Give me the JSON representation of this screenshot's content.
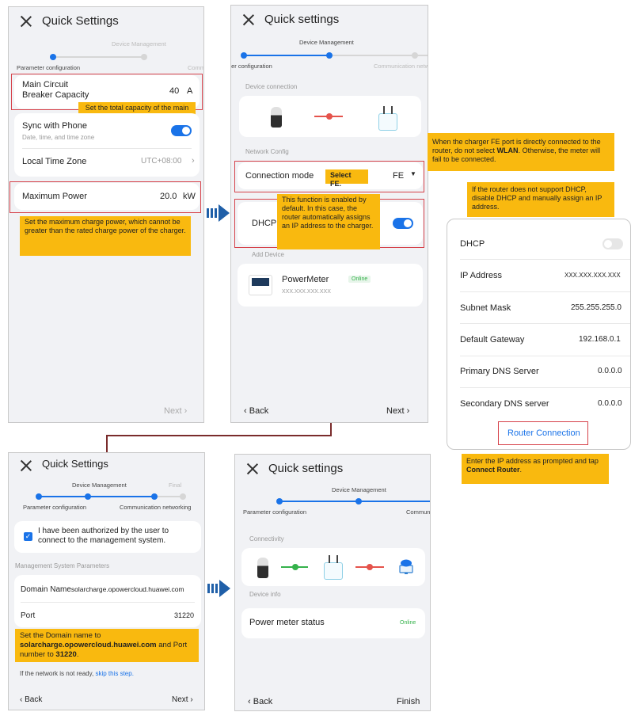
{
  "colors": {
    "accent": "#1a73e8",
    "note_bg": "#f9b90f",
    "highlight_border": "#d6424a",
    "online": "#35b24b"
  },
  "screen1": {
    "title": "Quick Settings",
    "steps": [
      "Device Management",
      "Parameter configuration",
      "Comm"
    ],
    "breaker_label_1": "Main Circuit",
    "breaker_label_2": "Breaker Capacity",
    "breaker_value": "40",
    "breaker_unit": "A",
    "sync_label": "Sync with Phone",
    "sync_sub": "Date, time, and time zone",
    "tz_label": "Local Time Zone",
    "tz_value": "UTC+08:00",
    "power_label": "Maximum Power",
    "power_value": "20.0",
    "power_unit": "kW",
    "next": "Next",
    "note_breaker": "Set the total capacity of the main circuit breaker.",
    "note_power": "Set the maximum charge power, which cannot be greater than the rated charge power of the charger."
  },
  "screen2": {
    "title": "Quick settings",
    "steps": [
      "Device Management",
      "ter configuration",
      "Communication netw"
    ],
    "device_connection": "Device connection",
    "network_config": "Network Config",
    "conn_mode_label": "Connection mode",
    "conn_mode_value": "FE",
    "dhcp_label": "DHCP",
    "add_device": "Add Device",
    "meter_name": "PowerMeter",
    "meter_status": "Online",
    "meter_addr": "XXX.XXX.XXX.XXX",
    "back": "Back",
    "next": "Next",
    "note_select": "Select FE.",
    "note_dhcp": "This function is enabled by default. In this case, the router automatically assigns an IP address to the charger."
  },
  "notes_right": {
    "fe_port_1": "When the charger FE port is directly connected to the router, do not select ",
    "fe_port_bold": "WLAN",
    "fe_port_2": ". Otherwise, the meter will fail to be connected.",
    "dhcp_router": "If the router does not support DHCP, disable DHCP and manually assign an IP address.",
    "enter_ip_1": "Enter the IP address as prompted and tap ",
    "enter_ip_bold": "Connect Router",
    "enter_ip_2": "."
  },
  "dhcp_panel": {
    "dhcp_label": "DHCP",
    "rows": [
      {
        "label": "IP Address",
        "value": "XXX.XXX.XXX.XXX"
      },
      {
        "label": "Subnet Mask",
        "value": "255.255.255.0"
      },
      {
        "label": "Default Gateway",
        "value": "192.168.0.1"
      },
      {
        "label": "Primary DNS Server",
        "value": "0.0.0.0"
      },
      {
        "label": "Secondary DNS server",
        "value": "0.0.0.0"
      }
    ],
    "router_button": "Router Connection"
  },
  "screen3": {
    "title": "Quick Settings",
    "steps": [
      "Device Management",
      "Final",
      "Parameter configuration",
      "Communication networking"
    ],
    "auth_text": "I have been authorized by the user to connect to the management system.",
    "mgmt_header": "Management System Parameters",
    "domain_label": "Domain Name",
    "domain_value": "solarcharge.opowercloud.huawei.com",
    "port_label": "Port",
    "port_value": "31220",
    "note_1": "Set the Domain name to ",
    "note_domain": "solarcharge.opowercloud.huawei.com",
    "note_2": " and Port number to ",
    "note_port": "31220",
    "note_3": ".",
    "network_text": "If the network is not ready, ",
    "skip_link": "skip this step.",
    "back": "Back",
    "next": "Next"
  },
  "screen4": {
    "title": "Quick settings",
    "steps": [
      "Device Management",
      "Parameter configuration",
      "Commun"
    ],
    "connectivity": "Connectivity",
    "device_info": "Device info",
    "meter_status_label": "Power meter status",
    "meter_status_value": "Online",
    "back": "Back",
    "finish": "Finish"
  }
}
